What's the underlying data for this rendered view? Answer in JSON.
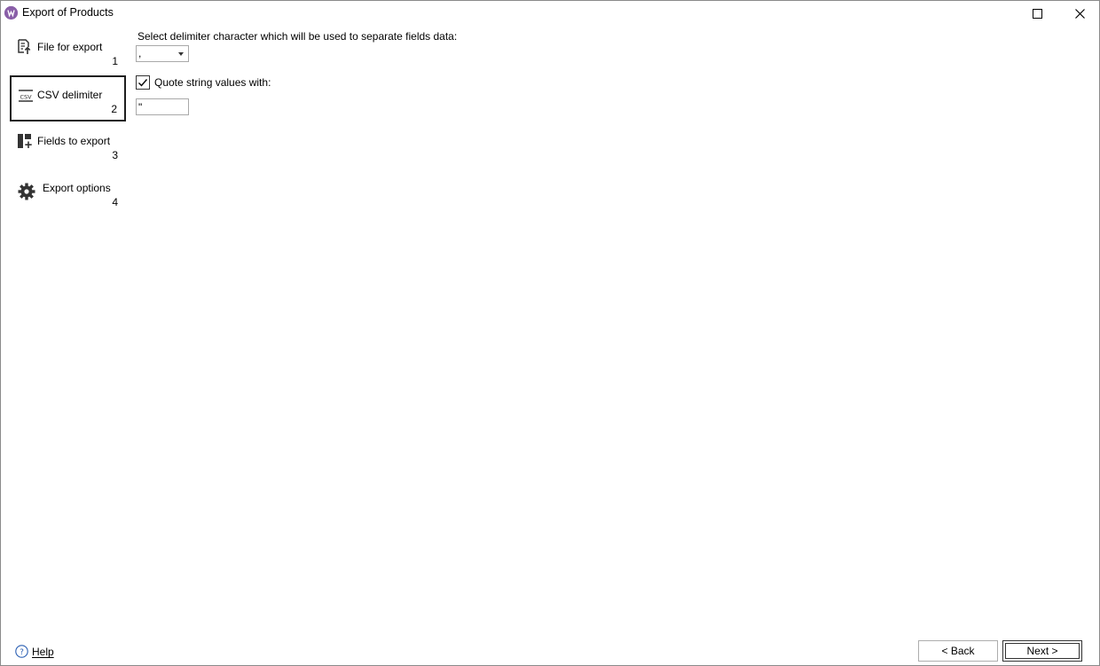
{
  "window": {
    "title": "Export of Products",
    "app_icon": "app-logo-icon",
    "controls": {
      "maximize": "maximize-icon",
      "close": "close-icon"
    }
  },
  "sidebar": {
    "items": [
      {
        "label": "File for export",
        "number": "1",
        "icon": "file-export-icon",
        "active": false
      },
      {
        "label": "CSV delimiter",
        "number": "2",
        "icon": "csv-icon",
        "active": true
      },
      {
        "label": "Fields to export",
        "number": "3",
        "icon": "fields-icon",
        "active": false
      },
      {
        "label": "Export options",
        "number": "4",
        "icon": "gear-icon",
        "active": false
      }
    ]
  },
  "content": {
    "delimiter_label": "Select delimiter character which will be used to separate fields data:",
    "delimiter_value": ",",
    "quote_checkbox_label": "Quote string values with:",
    "quote_checked": true,
    "quote_value": "\""
  },
  "footer": {
    "help_label": "Help",
    "back_label": "< Back",
    "next_label": "Next >"
  },
  "colors": {
    "accent": "#8a5fa8",
    "active_border": "#1e1e1e"
  }
}
